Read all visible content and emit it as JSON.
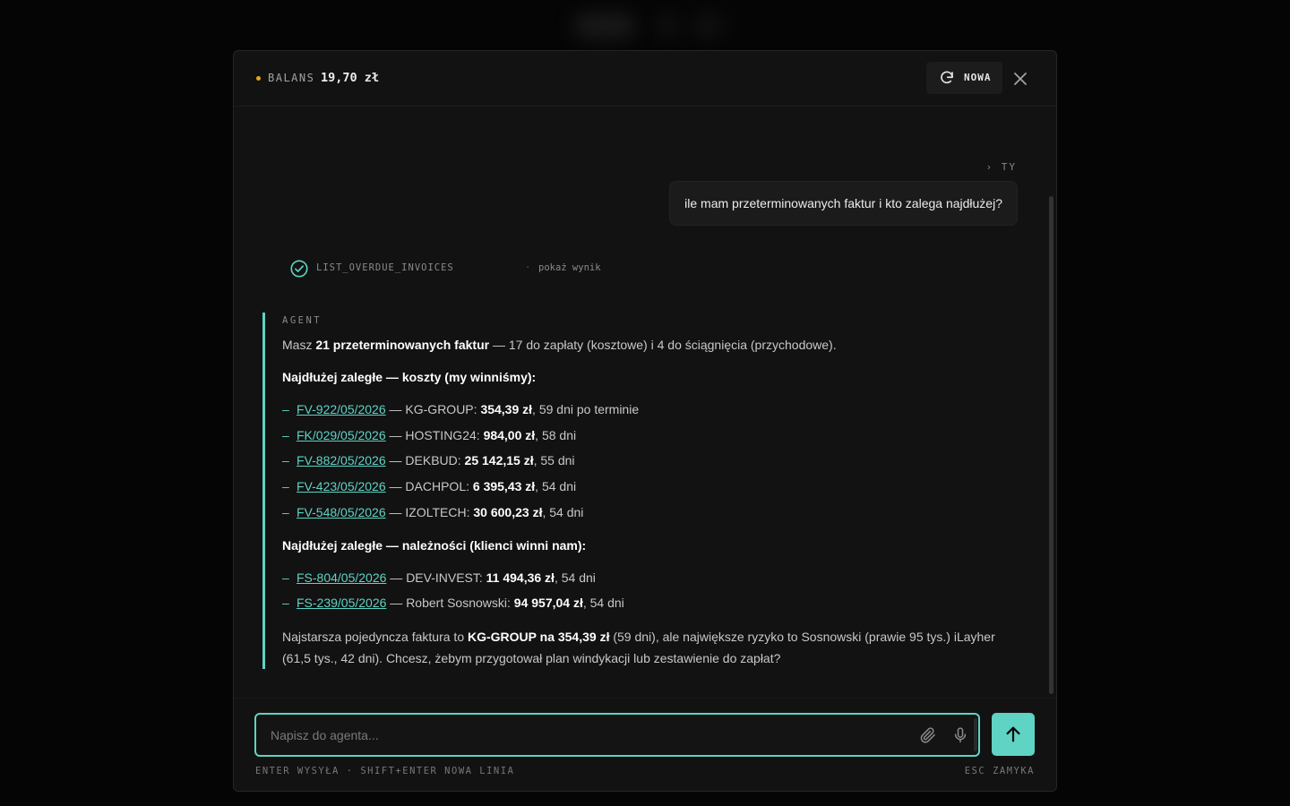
{
  "header": {
    "balance_label": "BALANS",
    "balance_value": "19,70 zł",
    "new_label": "NOWA",
    "accent_color": "#5fd3c4",
    "balance_dot_color": "#e6a817"
  },
  "conversation": {
    "user_role_label": "› TY",
    "user_message": "ile mam przeterminowanych faktur i kto zalega najdłużej?",
    "tool_call": {
      "name": "LIST_OVERDUE_INVOICES",
      "separator": "·",
      "link": "pokaż wynik",
      "status_icon": "check-circle-icon"
    },
    "agent": {
      "label": "AGENT",
      "intro": {
        "pre": "Masz ",
        "bold": "21 przeterminowanych faktur",
        "post": " — 17 do zapłaty (kosztowe) i 4 do ściągnięcia (przychodowe)."
      },
      "costs_heading": "Najdłużej zaległe — koszty (my winniśmy):",
      "costs": [
        {
          "dash": "–",
          "number": "FV-922/05/2026",
          "sep": " — ",
          "party": "KG-GROUP: ",
          "amount": "354,39 zł",
          "days": ", 59 dni po terminie"
        },
        {
          "dash": "–",
          "number": "FK/029/05/2026",
          "sep": " — ",
          "party": "HOSTING24: ",
          "amount": "984,00 zł",
          "days": ", 58 dni"
        },
        {
          "dash": "–",
          "number": "FV-882/05/2026",
          "sep": " — ",
          "party": "DEKBUD: ",
          "amount": "25 142,15 zł",
          "days": ", 55 dni"
        },
        {
          "dash": "–",
          "number": "FV-423/05/2026",
          "sep": " — ",
          "party": "DACHPOL: ",
          "amount": "6 395,43 zł",
          "days": ", 54 dni"
        },
        {
          "dash": "–",
          "number": "FV-548/05/2026",
          "sep": " — ",
          "party": "IZOLTECH: ",
          "amount": "30 600,23 zł",
          "days": ", 54 dni"
        }
      ],
      "receivables_heading": "Najdłużej zaległe — należności (klienci winni nam):",
      "receivables": [
        {
          "dash": "–",
          "number": "FS-804/05/2026",
          "sep": " — ",
          "party": "DEV-INVEST: ",
          "amount": "11 494,36 zł",
          "days": ", 54 dni"
        },
        {
          "dash": "–",
          "number": "FS-239/05/2026",
          "sep": " — ",
          "party": "Robert Sosnowski: ",
          "amount": "94 957,04 zł",
          "days": ", 54 dni"
        }
      ],
      "summary": {
        "pre": "Najstarsza pojedyncza faktura to ",
        "bold": "KG-GROUP na 354,39 zł",
        "post": " (59 dni), ale największe ryzyko to Sosnowski (prawie 95 tys.) iLayher (61,5 tys., 42 dni). Chcesz, żebym przygotował plan windykacji lub zestawienie do zapłat?"
      }
    }
  },
  "composer": {
    "placeholder": "Napisz do agenta...",
    "value": "",
    "hint_left": "ENTER WYSYŁA · SHIFT+ENTER NOWA LINIA",
    "hint_right": "ESC ZAMYKA"
  }
}
